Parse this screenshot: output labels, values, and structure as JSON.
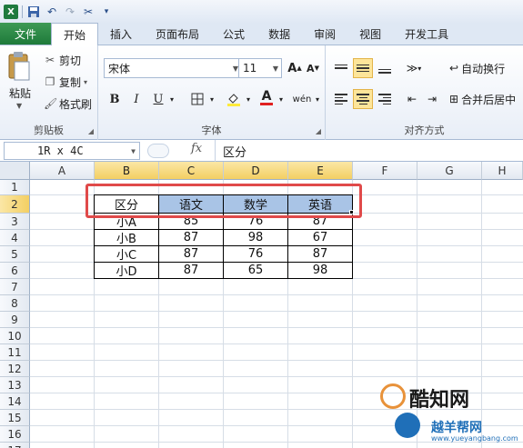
{
  "qat": {
    "icons": [
      "excel-icon",
      "save-icon",
      "undo-icon",
      "redo-icon",
      "tools-icon"
    ]
  },
  "tabs": {
    "file": "文件",
    "items": [
      "开始",
      "插入",
      "页面布局",
      "公式",
      "数据",
      "审阅",
      "视图",
      "开发工具"
    ],
    "active": "开始"
  },
  "ribbon": {
    "clipboard": {
      "paste": "粘贴",
      "cut": "剪切",
      "copy": "复制",
      "format_painter": "格式刷",
      "group_label": "剪贴板"
    },
    "font": {
      "font_name": "宋体",
      "font_size": "11",
      "bold": "B",
      "italic": "I",
      "underline": "U",
      "phonetic": "wén",
      "group_label": "字体"
    },
    "alignment": {
      "wrap_text": "自动换行",
      "merge_center": "合并后居中",
      "group_label": "对齐方式"
    }
  },
  "formula_bar": {
    "name_box": "1R x 4C",
    "fx": "fx",
    "content": "区分"
  },
  "grid": {
    "columns": [
      "A",
      "B",
      "C",
      "D",
      "E",
      "F",
      "G",
      "H"
    ],
    "rows": [
      "1",
      "2",
      "3",
      "4",
      "5",
      "6",
      "7",
      "8",
      "9",
      "10",
      "11",
      "12",
      "13",
      "14",
      "15",
      "16",
      "17"
    ]
  },
  "table": {
    "headers": [
      "区分",
      "语文",
      "数学",
      "英语"
    ],
    "rows": [
      [
        "小A",
        "85",
        "76",
        "87"
      ],
      [
        "小B",
        "87",
        "98",
        "67"
      ],
      [
        "小C",
        "87",
        "76",
        "87"
      ],
      [
        "小D",
        "87",
        "65",
        "98"
      ]
    ]
  },
  "watermark": {
    "title": "酷知网",
    "subtitle": "越羊帮网",
    "url": "www.yueyangbang.com"
  },
  "colors": {
    "file_tab": "#1e7a3a",
    "selection_header": "#f3cf63",
    "highlight": "#e04a4a",
    "header_fill": "#a9c4e6"
  }
}
